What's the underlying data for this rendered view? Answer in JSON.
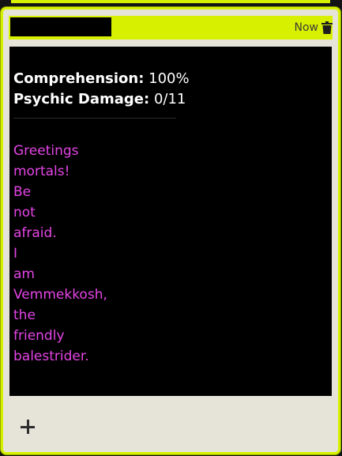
{
  "header": {
    "time_label": "Now"
  },
  "stats": {
    "comprehension_label": "Comprehension:",
    "comprehension_value": "100%",
    "psychic_damage_label": "Psychic Damage:",
    "psychic_damage_value": "0/11"
  },
  "message": "Greetings mortals! Be not afraid. I am Vemmekkosh, the friendly balestrider.",
  "colors": {
    "accent": "#d7f000",
    "message_text": "#e545e6",
    "content_bg": "#000000",
    "card_bg": "#e6e3d8"
  },
  "icons": {
    "delete": "trash-icon",
    "add": "plus-icon"
  }
}
